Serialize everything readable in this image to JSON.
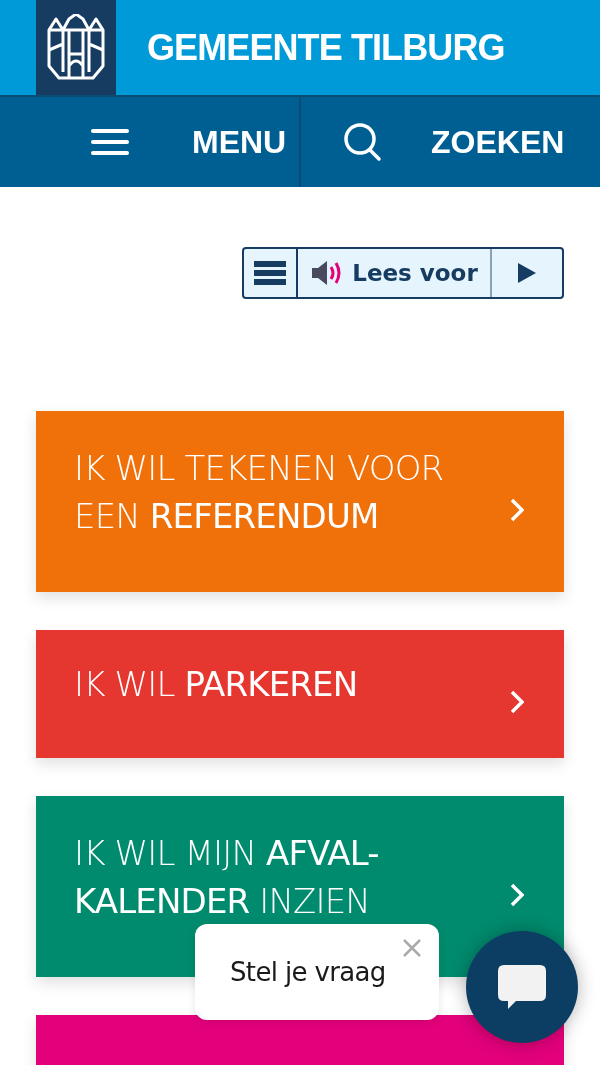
{
  "header": {
    "title": "GEMEENTE TILBURG"
  },
  "nav": [
    {
      "kind": "menu",
      "label": "MENU"
    },
    {
      "kind": "search",
      "label": "ZOEKEN"
    }
  ],
  "read_aloud": {
    "label": "Lees voor"
  },
  "tiles": [
    {
      "text": "IK WIL TEKENEN VOOR EEN **REFERENDUM**",
      "color": "#f07009"
    },
    {
      "text": "IK WIL **PARKEREN**",
      "color": "#e5362f"
    },
    {
      "text": "IK WIL MIJN **AFVAL-KALENDER** INZIEN",
      "color": "#008b6e"
    },
    {
      "color": "#e3007b"
    }
  ],
  "chat": {
    "prompt": "Stel je vraag"
  }
}
